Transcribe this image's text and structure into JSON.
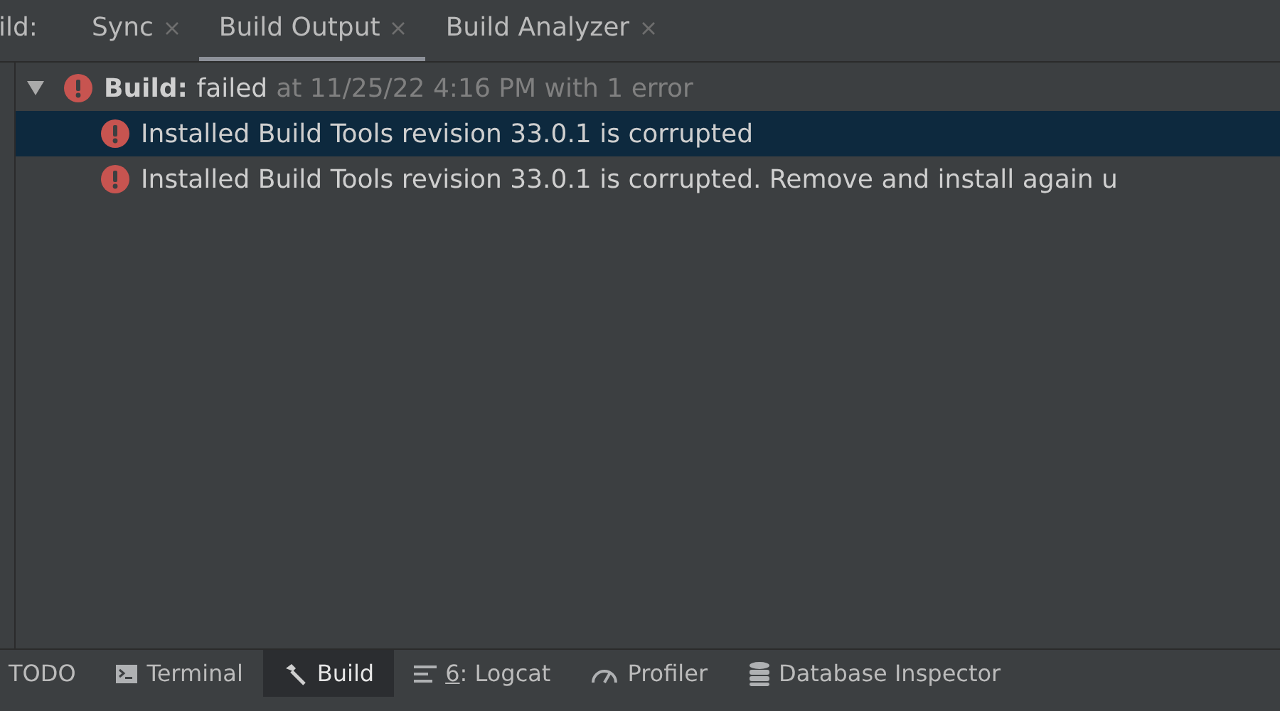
{
  "header_label": "ild:",
  "tabs": [
    {
      "label": "Sync",
      "selected": false
    },
    {
      "label": "Build Output",
      "selected": true
    },
    {
      "label": "Build Analyzer",
      "selected": false
    }
  ],
  "tree": [
    {
      "label": "Build:",
      "status": "failed",
      "detail": "at 11/25/22 4:16 PM with 1 error",
      "expanded": true,
      "selected": false,
      "children": [
        {
          "label": "Installed Build Tools revision 33.0.1 is corrupted",
          "selected": true
        },
        {
          "label": "Installed Build Tools revision 33.0.1 is corrupted. Remove and install again u",
          "selected": false
        }
      ]
    }
  ],
  "tool_windows": [
    {
      "kind": "text",
      "label": "TODO",
      "selected": false
    },
    {
      "kind": "terminal",
      "label": "Terminal",
      "selected": false
    },
    {
      "kind": "hammer",
      "label": "Build",
      "selected": true
    },
    {
      "kind": "lines",
      "mnemonic": "6",
      "label": ": Logcat",
      "selected": false
    },
    {
      "kind": "gauge",
      "label": "Profiler",
      "selected": false
    },
    {
      "kind": "database",
      "label": "Database Inspector",
      "selected": false
    }
  ]
}
